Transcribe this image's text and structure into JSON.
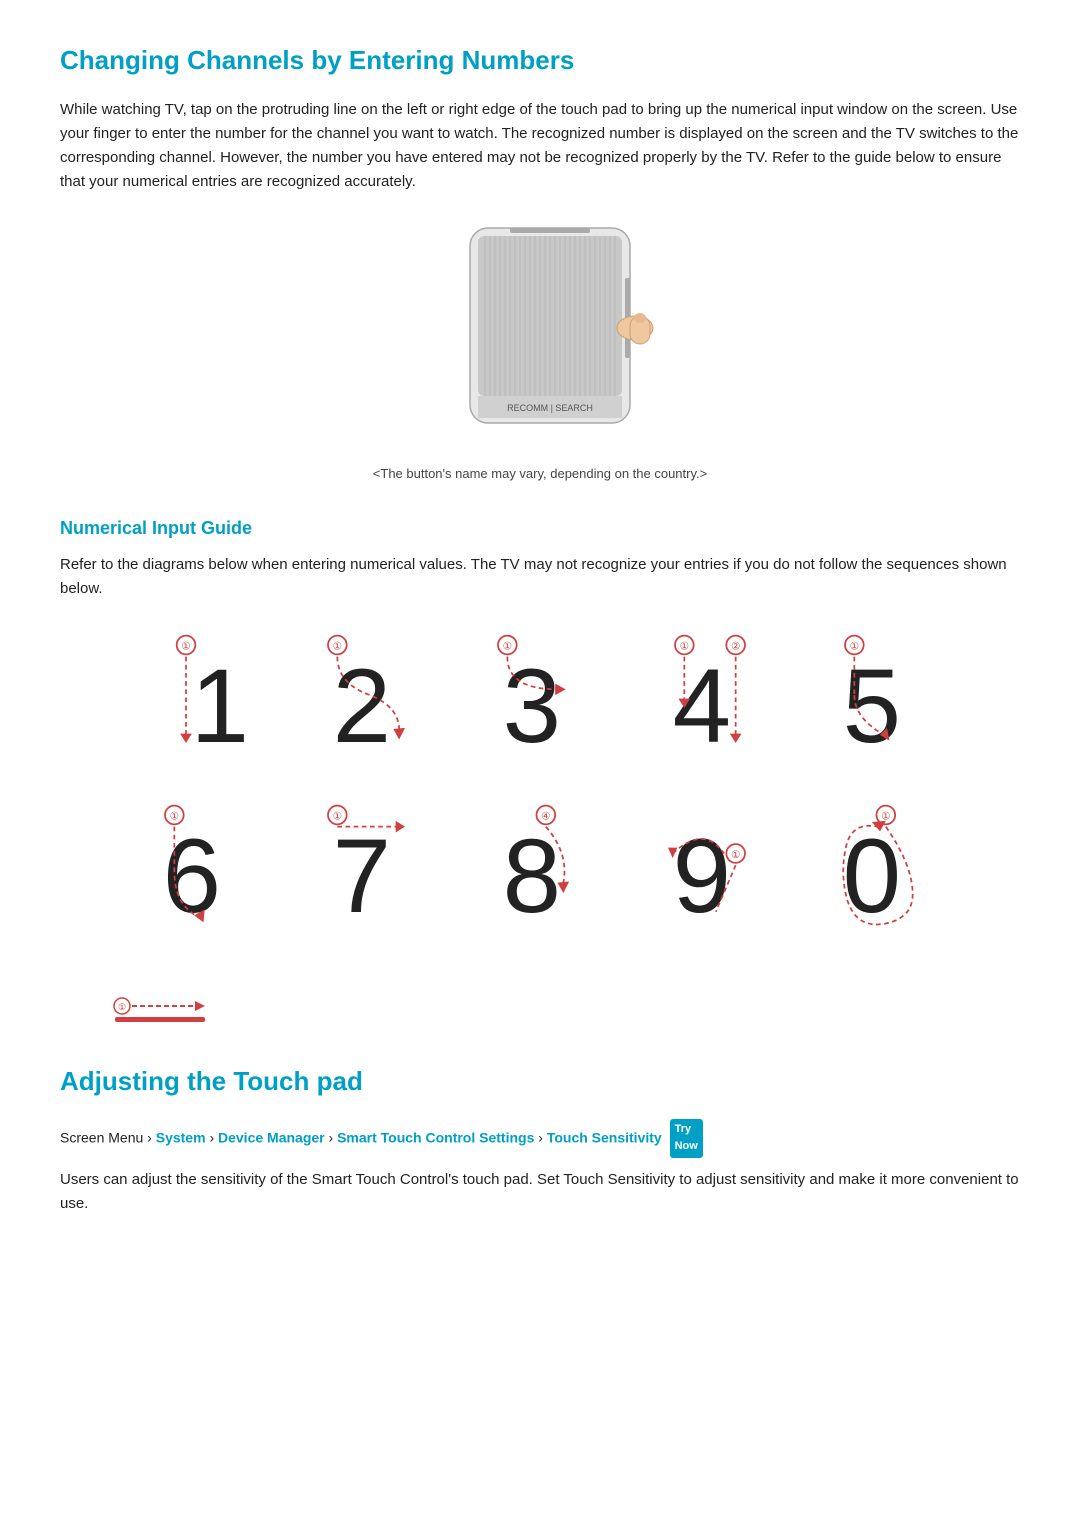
{
  "page": {
    "title": "Changing Channels by Entering Numbers",
    "intro": "While watching TV, tap on the protruding line on the left or right edge of the touch pad to bring up the numerical input window on the screen. Use your finger to enter the number for the channel you want to watch. The recognized number is displayed on the screen and the TV switches to the corresponding channel. However, the number you have entered may not be recognized properly by the TV. Refer to the guide below to ensure that your numerical entries are recognized accurately.",
    "image_caption": "<The button's name may vary, depending on the country.>",
    "sub_section_title": "Numerical Input Guide",
    "sub_section_intro": "Refer to the diagrams below when entering numerical values. The TV may not recognize your entries if you do not follow the sequences shown below.",
    "adjusting_title": "Adjusting the Touch pad",
    "breadcrumb_plain": "Screen Menu ",
    "breadcrumb_links": [
      "System",
      "Device Manager",
      "Smart Touch Control Settings",
      "Touch Sensitivity"
    ],
    "try_now_label": "Try Now",
    "adjusting_body_start": "Users can adjust the sensitivity of the Smart Touch Control's touch pad. Set ",
    "adjusting_body_link": "Touch Sensitivity",
    "adjusting_body_end": " to adjust sensitivity and make it more convenient to use.",
    "numbers": [
      "1",
      "2",
      "3",
      "4",
      "5",
      "6",
      "7",
      "8",
      "9",
      "0"
    ],
    "chevron": "›"
  }
}
